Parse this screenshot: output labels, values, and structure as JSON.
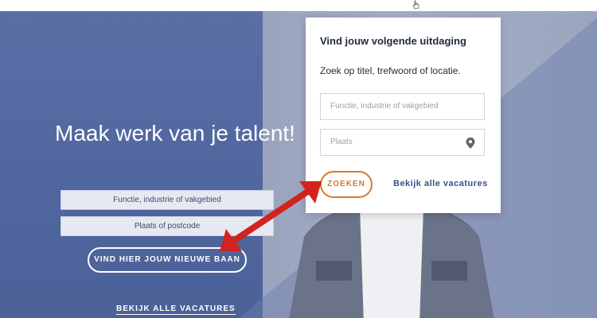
{
  "hero": {
    "title": "Maak werk van je talent!",
    "field_function": "Functie, industrie of vakgebied",
    "field_location": "Plaats of postcode",
    "cta_label": "VIND HIER JOUW NIEUWE BAAN",
    "all_vacancies_link": "BEKIJK ALLE VACATURES"
  },
  "search_card": {
    "title": "Vind jouw volgende uitdaging",
    "subtitle": "Zoek op titel, trefwoord of locatie.",
    "function_placeholder": "Functie, industrie of vakgebied",
    "location_placeholder": "Plaats",
    "search_button": "ZOEKEN",
    "all_vacancies_link": "Bekijk alle vacatures"
  },
  "icons": {
    "location": "map-pin-icon",
    "cursor": "hand-cursor-icon",
    "annotation": "double-arrow-icon"
  },
  "colors": {
    "hero_blue": "#5a6fa6",
    "accent_orange": "#d9772c",
    "link_blue": "#3d4f8a",
    "annotation_red": "#d2231f"
  }
}
